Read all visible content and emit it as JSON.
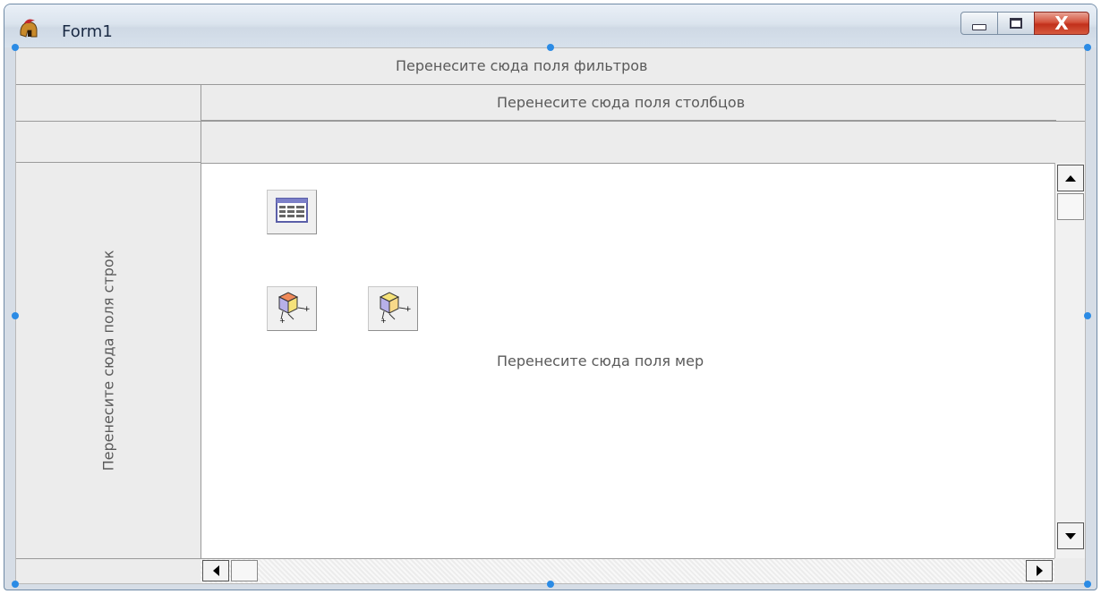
{
  "window": {
    "title": "Form1",
    "icon": "spartan-helmet-icon",
    "caption_buttons": [
      "minimize-icon",
      "maximize-icon",
      "close-icon"
    ],
    "close_glyph": "X"
  },
  "pivot": {
    "filter_area": "Перенесите сюда поля фильтров",
    "column_area": "Перенесите сюда поля столбцов",
    "row_area": "Перенесите сюда поля строк",
    "measure_area": "Перенесите сюда поля мер"
  },
  "icons": {
    "grid": "grid-view-icon",
    "cube1": "cube-dimension-icon",
    "cube2": "cube-measure-icon"
  },
  "colors": {
    "accent": "#2b8be5",
    "close_button": "#c2301b"
  }
}
